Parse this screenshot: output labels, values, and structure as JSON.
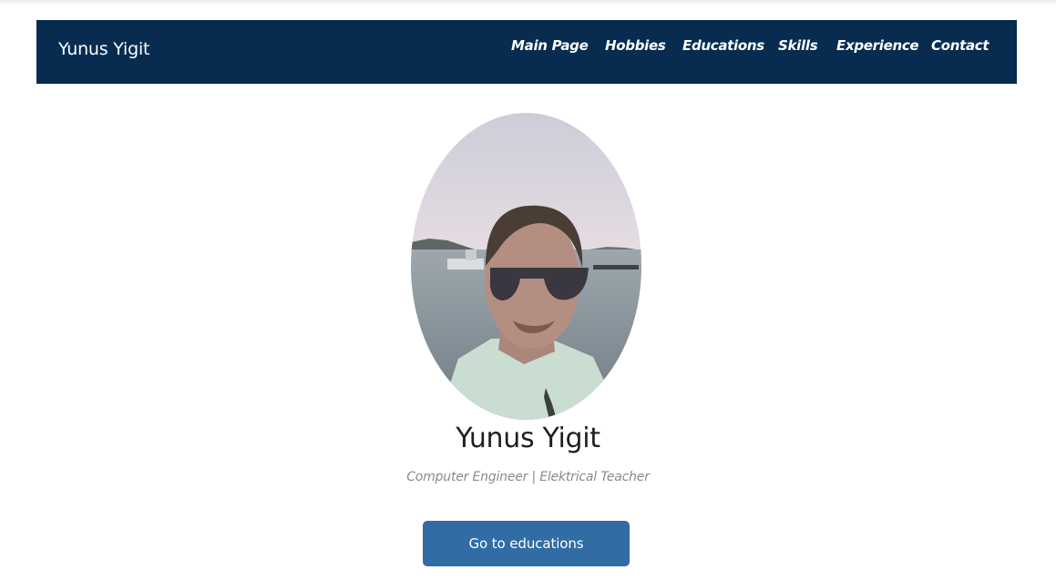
{
  "navbar": {
    "brand": "Yunus Yigit",
    "links": [
      "Main Page",
      "Hobbies",
      "Educations",
      "Skills",
      "Experience",
      "Contact"
    ]
  },
  "profile": {
    "name": "Yunus Yigit",
    "subtitle": "Computer Engineer | Elektrical Teacher",
    "cta_label": "Go to educations"
  },
  "colors": {
    "navbar_bg": "#072c50",
    "button_bg": "#316ca4"
  }
}
